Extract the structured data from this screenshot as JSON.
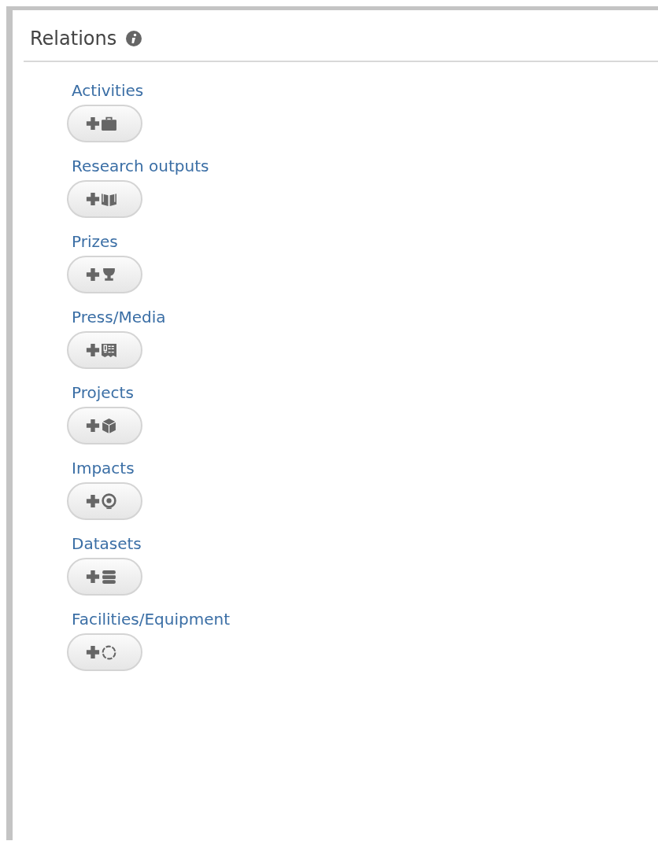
{
  "panel": {
    "title": "Relations"
  },
  "relations": [
    {
      "label": "Activities",
      "kind": "briefcase"
    },
    {
      "label": "Research outputs",
      "kind": "book"
    },
    {
      "label": "Prizes",
      "kind": "trophy"
    },
    {
      "label": "Press/Media",
      "kind": "newspaper"
    },
    {
      "label": "Projects",
      "kind": "cube"
    },
    {
      "label": "Impacts",
      "kind": "target"
    },
    {
      "label": "Datasets",
      "kind": "database"
    },
    {
      "label": "Facilities/Equipment",
      "kind": "ring"
    }
  ]
}
